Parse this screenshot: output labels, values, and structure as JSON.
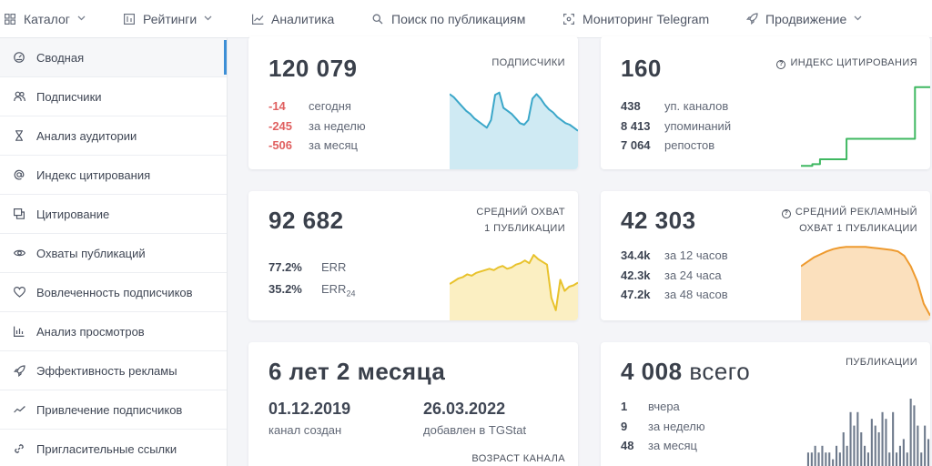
{
  "nav": {
    "items": [
      {
        "label": "Каталог",
        "icon": "grid-icon",
        "dropdown": true
      },
      {
        "label": "Рейтинги",
        "icon": "rating-icon",
        "dropdown": true
      },
      {
        "label": "Аналитика",
        "icon": "chart-icon",
        "dropdown": false
      },
      {
        "label": "Поиск по публикациям",
        "icon": "search-icon",
        "dropdown": false
      },
      {
        "label": "Мониторинг Telegram",
        "icon": "monitor-icon",
        "dropdown": false
      },
      {
        "label": "Продвижение",
        "icon": "rocket-icon",
        "dropdown": true
      }
    ]
  },
  "sidebar": {
    "items": [
      {
        "label": "Сводная",
        "icon": "dashboard-icon",
        "active": true
      },
      {
        "label": "Подписчики",
        "icon": "users-icon"
      },
      {
        "label": "Анализ аудитории",
        "icon": "hourglass-icon"
      },
      {
        "label": "Индекс цитирования",
        "icon": "at-icon"
      },
      {
        "label": "Цитирование",
        "icon": "quote-icon"
      },
      {
        "label": "Охваты публикаций",
        "icon": "eye-icon"
      },
      {
        "label": "Вовлеченность подписчиков",
        "icon": "heart-icon"
      },
      {
        "label": "Анализ просмотров",
        "icon": "bar-chart-icon"
      },
      {
        "label": "Эффективность рекламы",
        "icon": "rocket-icon"
      },
      {
        "label": "Привлечение подписчиков",
        "icon": "trend-icon"
      },
      {
        "label": "Пригласительные ссылки",
        "icon": "link-icon"
      }
    ]
  },
  "cards": {
    "subscribers": {
      "value": "120 079",
      "label": "ПОДПИСЧИКИ",
      "rows": [
        {
          "v": "-14",
          "t": "сегодня"
        },
        {
          "v": "-245",
          "t": "за неделю"
        },
        {
          "v": "-506",
          "t": "за месяц"
        }
      ]
    },
    "citation": {
      "value": "160",
      "label": "ИНДЕКС ЦИТИРОВАНИЯ",
      "rows": [
        {
          "v": "438",
          "t": "уп. каналов"
        },
        {
          "v": "8 413",
          "t": "упоминаний"
        },
        {
          "v": "7 064",
          "t": "репостов"
        }
      ]
    },
    "reach": {
      "value": "92 682",
      "label_line1": "СРЕДНИЙ ОХВАТ",
      "label_line2": "1 ПУБЛИКАЦИИ",
      "err_value": "77.2%",
      "err_label": "ERR",
      "err24_value": "35.2%",
      "err24_label": "ERR",
      "err24_sub": "24"
    },
    "ad_reach": {
      "value": "42 303",
      "label_line1": "СРЕДНИЙ РЕКЛАМНЫЙ",
      "label_line2": "ОХВАТ 1 ПУБЛИКАЦИИ",
      "rows": [
        {
          "v": "34.4k",
          "t": "за 12 часов"
        },
        {
          "v": "42.3k",
          "t": "за 24 часа"
        },
        {
          "v": "47.2k",
          "t": "за 48 часов"
        }
      ]
    },
    "age": {
      "value": "6 лет 2 месяца",
      "created_date": "01.12.2019",
      "created_label": "канал создан",
      "added_date": "26.03.2022",
      "added_label": "добавлен в TGStat",
      "label": "ВОЗРАСТ КАНАЛА"
    },
    "posts": {
      "value": "4 008",
      "value_suffix": "всего",
      "label": "ПУБЛИКАЦИИ",
      "rows": [
        {
          "v": "1",
          "t": "вчера"
        },
        {
          "v": "9",
          "t": "за неделю"
        },
        {
          "v": "48",
          "t": "за месяц"
        }
      ]
    }
  },
  "colors": {
    "subscribers_line": "#3ba7c9",
    "subscribers_fill": "#cfeaf3",
    "citation_line": "#3fb861",
    "reach_line": "#e8c22c",
    "reach_fill": "#fbefc2",
    "ad_line": "#ee9a2e",
    "ad_fill": "#fbe0bd",
    "posts_bar": "#6e7a8c",
    "negative": "#e06060",
    "active_accent": "#3d8fd6"
  },
  "chart_data": [
    {
      "type": "area",
      "name": "subscribers_trend",
      "values": [
        96,
        92,
        86,
        80,
        74,
        70,
        64,
        60,
        56,
        52,
        62,
        95,
        98,
        78,
        74,
        70,
        64,
        58,
        56,
        62,
        90,
        96,
        90,
        82,
        76,
        72,
        66,
        62,
        58,
        56,
        52,
        48
      ]
    },
    {
      "type": "line",
      "name": "citation_trend",
      "values": [
        2,
        2,
        2,
        4,
        4,
        10,
        10,
        10,
        10,
        10,
        10,
        10,
        35,
        35,
        35,
        35,
        35,
        35,
        35,
        35,
        35,
        35,
        35,
        35,
        35,
        35,
        35,
        35,
        35,
        35,
        98,
        98,
        98,
        98,
        98
      ]
    },
    {
      "type": "area",
      "name": "reach_trend",
      "values": [
        50,
        54,
        58,
        60,
        64,
        62,
        66,
        68,
        70,
        72,
        70,
        74,
        76,
        72,
        74,
        78,
        80,
        84,
        80,
        92,
        86,
        82,
        78,
        30,
        12,
        56,
        40,
        46,
        48,
        52
      ]
    },
    {
      "type": "area",
      "name": "ad_reach_trend",
      "values": [
        70,
        76,
        82,
        86,
        90,
        93,
        95,
        96,
        96,
        96,
        96,
        95,
        94,
        93,
        92,
        90,
        84,
        70,
        50,
        20,
        4
      ]
    },
    {
      "type": "bar",
      "name": "posts_daily",
      "values": [
        2,
        2,
        3,
        2,
        3,
        2,
        2,
        1,
        3,
        2,
        5,
        3,
        8,
        6,
        8,
        5,
        3,
        2,
        7,
        6,
        5,
        8,
        7,
        2,
        8,
        2,
        3,
        4,
        2,
        10,
        9,
        6,
        2,
        6,
        4
      ]
    }
  ]
}
